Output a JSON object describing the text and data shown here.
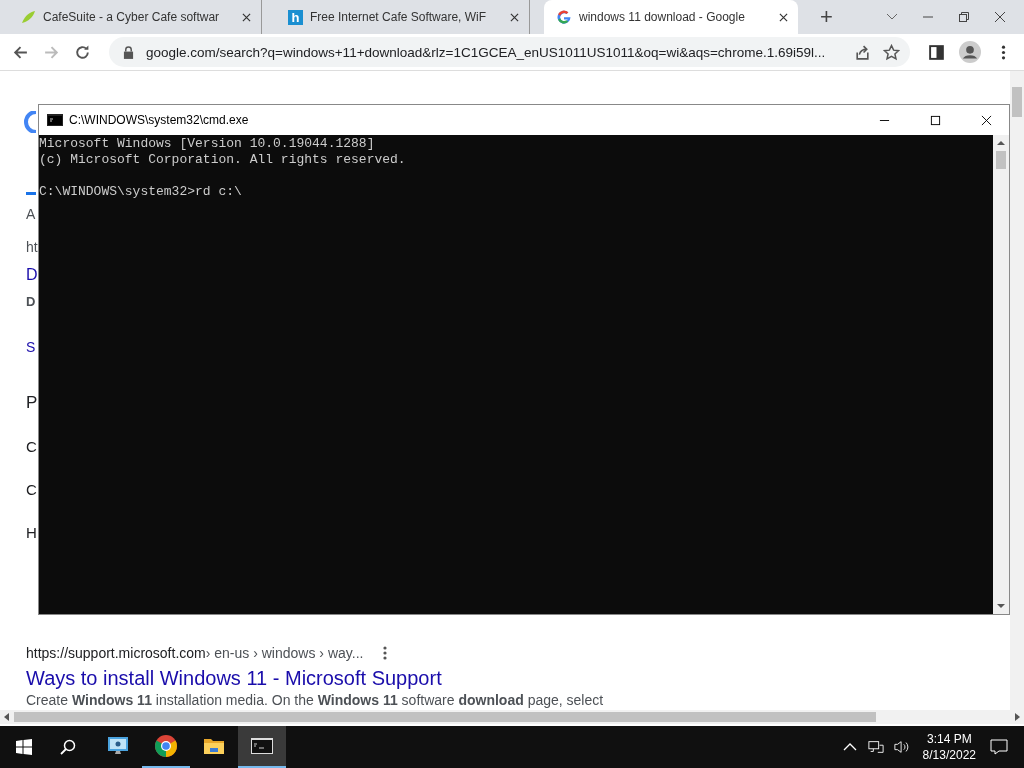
{
  "browser": {
    "tabs": [
      {
        "title": "CafeSuite - a Cyber Cafe softwar",
        "selected": false
      },
      {
        "title": "Free Internet Cafe Software, WiF",
        "icon_text": "h",
        "selected": false
      },
      {
        "title": "windows 11 download - Google",
        "selected": true
      }
    ],
    "new_tab": "+",
    "address": "google.com/search?q=windows+11+download&rlz=1C1GCEA_enUS1011US1011&oq=wi&aqs=chrome.1.69i59l..."
  },
  "page": {
    "partial_lines": [
      {
        "text": "A",
        "kind": "small"
      },
      {
        "text": "ht",
        "kind": "url"
      },
      {
        "text": "D",
        "kind": "link"
      },
      {
        "text": "D",
        "kind": "bold"
      },
      {
        "text": "S",
        "kind": "sublink"
      },
      {
        "text": "P",
        "kind": "heading"
      },
      {
        "text": "C",
        "kind": "question"
      },
      {
        "text": "C",
        "kind": "question"
      },
      {
        "text": "H",
        "kind": "question"
      }
    ],
    "result": {
      "url": "https://support.microsoft.com",
      "path": " › en-us › windows › way...",
      "title": "Ways to install Windows 11 - Microsoft Support",
      "snippet": "Create **Windows 11** installation media. On the **Windows 11** software **download** page, select"
    }
  },
  "console": {
    "title": "C:\\WINDOWS\\system32\\cmd.exe",
    "banner": [
      "Microsoft Windows [Version 10.0.19044.1288]",
      "(c) Microsoft Corporation. All rights reserved."
    ],
    "prompt": "C:\\WINDOWS\\system32>rd c:\\"
  },
  "taskbar": {
    "apps": [
      {
        "kind": "remote",
        "running": false,
        "selected": false
      },
      {
        "kind": "chrome",
        "running": true,
        "selected": false
      },
      {
        "kind": "folder",
        "running": false,
        "selected": false
      },
      {
        "kind": "console",
        "running": true,
        "selected": true
      }
    ],
    "time": "3:14 PM",
    "date": "8/13/2022"
  }
}
